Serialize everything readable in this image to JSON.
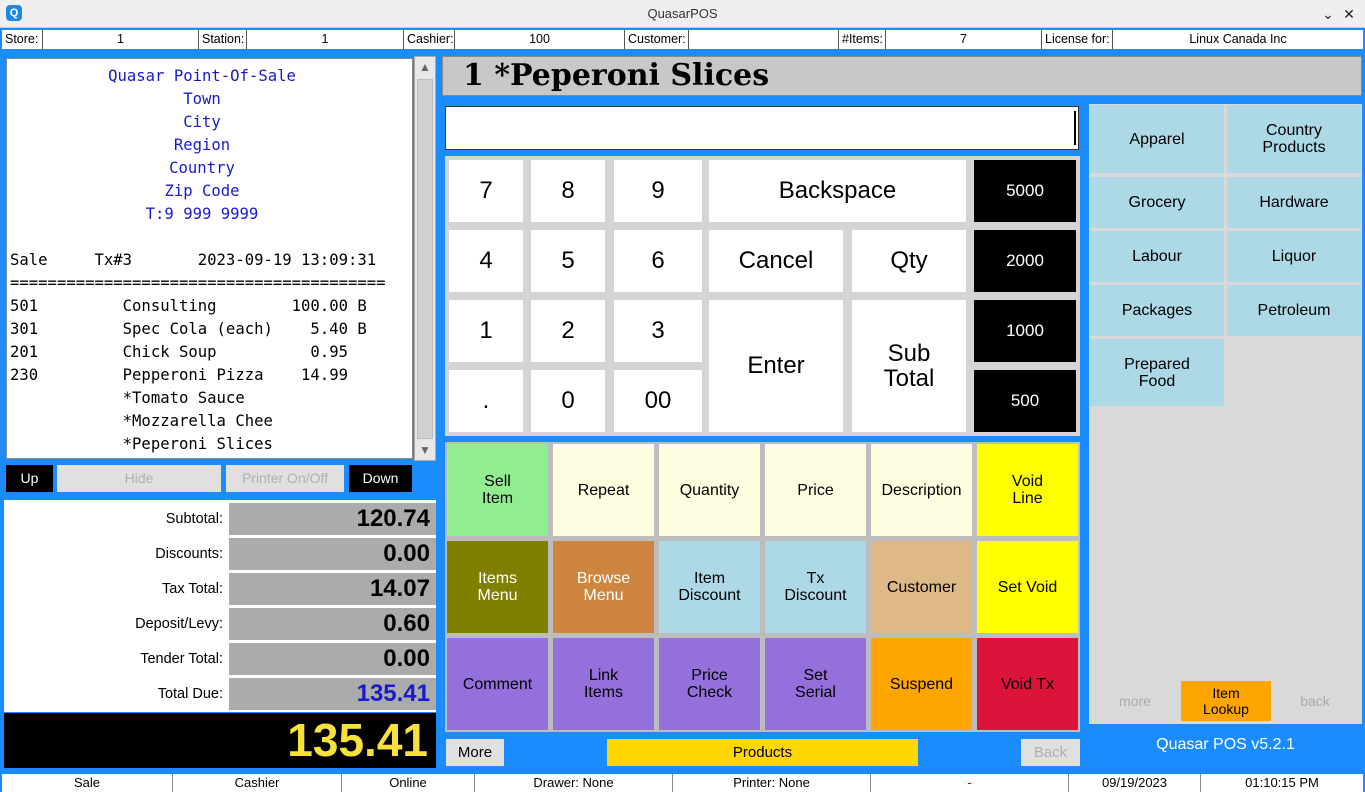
{
  "window": {
    "title": "QuasarPOS",
    "icon": "Q"
  },
  "infobar": {
    "store_label": "Store:",
    "store": "1",
    "station_label": "Station:",
    "station": "1",
    "cashier_label": "Cashier:",
    "cashier": "100",
    "customer_label": "Customer:",
    "customer": "",
    "items_label": "#Items:",
    "items": "7",
    "license_label": "License for:",
    "license": "Linux Canada Inc"
  },
  "receipt": {
    "header": [
      "Quasar Point-Of-Sale",
      "Town",
      "City",
      "Region",
      "Country",
      "Zip Code",
      "T:9 999 9999"
    ],
    "lines": [
      "",
      "Sale     Tx#3       2023-09-19 13:09:31",
      "========================================",
      "501         Consulting        100.00 B",
      "301         Spec Cola (each)    5.40 B",
      "201         Chick Soup          0.95",
      "230         Pepperoni Pizza    14.99",
      "            *Tomato Sauce",
      "            *Mozzarella Chee",
      "            *Peperoni Slices"
    ],
    "buttons": {
      "up": "Up",
      "hide": "Hide",
      "printer": "Printer On/Off",
      "down": "Down"
    }
  },
  "totals": {
    "subtotal_label": "Subtotal:",
    "subtotal": "120.74",
    "discounts_label": "Discounts:",
    "discounts": "0.00",
    "tax_label": "Tax Total:",
    "tax": "14.07",
    "deposit_label": "Deposit/Levy:",
    "deposit": "0.60",
    "tender_label": "Tender Total:",
    "tender": "0.00",
    "due_label": "Total Due:",
    "due": "135.41",
    "big_total": "135.41"
  },
  "item_title": "1  *Peperoni Slices",
  "entry_value": "",
  "keypad": {
    "k7": "7",
    "k8": "8",
    "k9": "9",
    "k4": "4",
    "k5": "5",
    "k6": "6",
    "k1": "1",
    "k2": "2",
    "k3": "3",
    "kdot": ".",
    "k0": "0",
    "k00": "00",
    "backspace": "Backspace",
    "cancel": "Cancel",
    "qty": "Qty",
    "enter": "Enter",
    "subtotal": "Sub Total",
    "d5000": "5000",
    "d2000": "2000",
    "d1000": "1000",
    "d500": "500"
  },
  "functions": {
    "sell_item": "Sell Item",
    "repeat": "Repeat",
    "quantity": "Quantity",
    "price": "Price",
    "description": "Description",
    "void_line": "Void Line",
    "items_menu": "Items Menu",
    "browse_menu": "Browse Menu",
    "item_discount": "Item Discount",
    "tx_discount": "Tx Discount",
    "customer": "Customer",
    "set_void": "Set Void",
    "comment": "Comment",
    "link_items": "Link Items",
    "price_check": "Price Check",
    "set_serial": "Set Serial",
    "suspend": "Suspend",
    "void_tx": "Void Tx"
  },
  "bottom_buttons": {
    "more": "More",
    "products": "Products",
    "back": "Back"
  },
  "departments": {
    "apparel": "Apparel",
    "country_products": "Country Products",
    "grocery": "Grocery",
    "hardware": "Hardware",
    "labour": "Labour",
    "liquor": "Liquor",
    "packages": "Packages",
    "petroleum": "Petroleum",
    "prepared_food": "Prepared Food",
    "more": "more",
    "item_lookup": "Item Lookup",
    "back": "back"
  },
  "version": "Quasar POS v5.2.1",
  "statusbar": {
    "mode": "Sale",
    "role": "Cashier",
    "connection": "Online",
    "drawer": "Drawer: None",
    "printer": "Printer: None",
    "dash": "-",
    "date": "09/19/2023",
    "time": "01:10:15 PM"
  },
  "colors": {
    "background": "#1a8cff",
    "sell": "#90ee90",
    "cream": "#fffde0",
    "yellow": "#ffff00",
    "olive": "#808000",
    "peru": "#cd853f",
    "lightblue": "#add8e6",
    "tan": "#deb887",
    "purple": "#9370db",
    "orange": "#ffa500",
    "crimson": "#dc143c",
    "gold": "#ffd700"
  }
}
